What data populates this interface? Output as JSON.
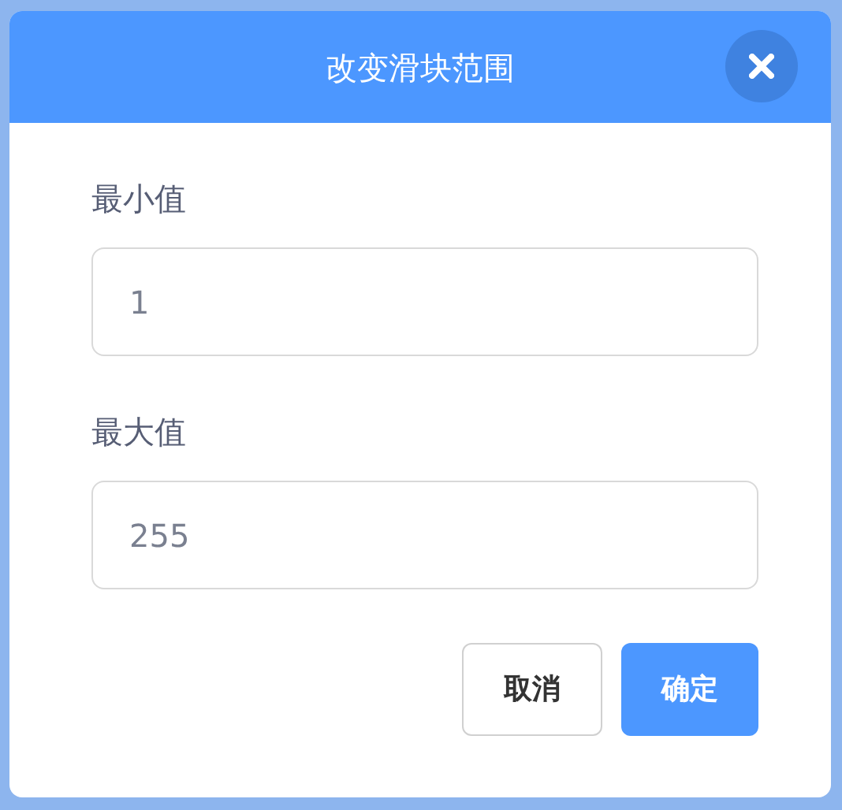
{
  "dialog": {
    "title": "改变滑块范围"
  },
  "fields": [
    {
      "label": "最小值",
      "value": "1"
    },
    {
      "label": "最大值",
      "value": "255"
    }
  ],
  "buttons": [
    {
      "label": "取消",
      "kind": "secondary"
    },
    {
      "label": "确定",
      "kind": "primary"
    }
  ]
}
